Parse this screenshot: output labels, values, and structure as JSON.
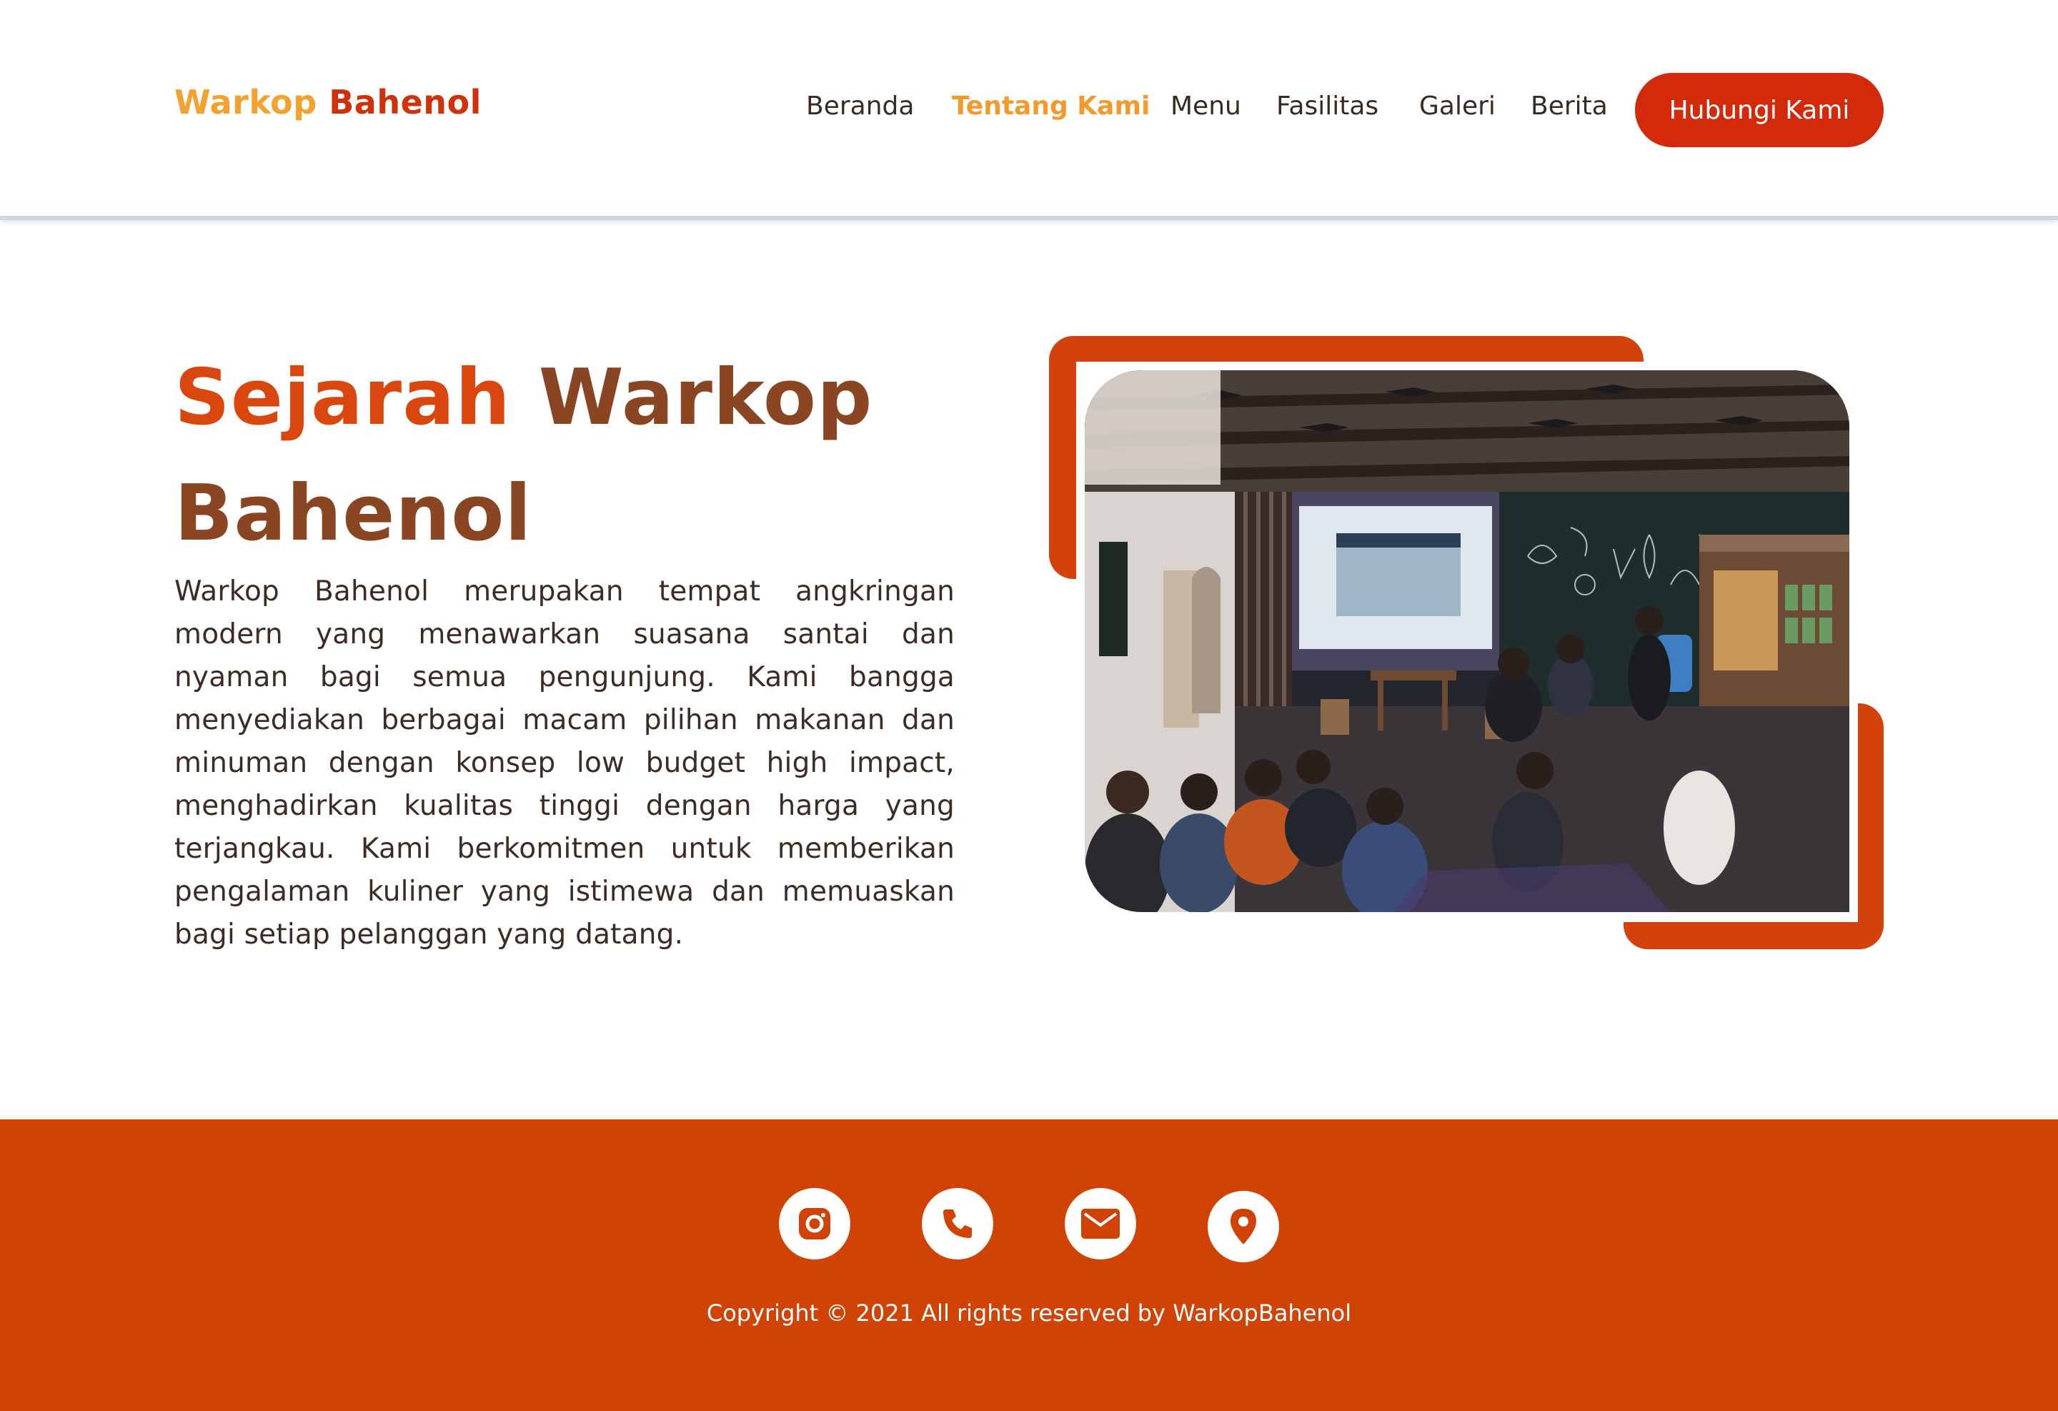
{
  "header": {
    "logo_part1": "Warkop",
    "logo_part2": "Bahenol",
    "nav": [
      {
        "label": "Beranda"
      },
      {
        "label": "Tentang Kami"
      },
      {
        "label": "Menu"
      },
      {
        "label": "Fasilitas"
      },
      {
        "label": "Galeri"
      },
      {
        "label": "Berita"
      }
    ],
    "active_nav": "Tentang Kami",
    "cta_label": "Hubungi Kami"
  },
  "main": {
    "title_part1": "Sejarah",
    "title_part2": "Warkop Bahenol",
    "description": "Warkop Bahenol merupakan tempat angkringan modern yang menawarkan suasana santai dan nyaman bagi semua pengunjung. Kami bangga menyediakan berbagai macam pilihan makanan dan minuman dengan konsep low budget high impact, menghadirkan kualitas tinggi dengan harga yang terjangkau. Kami berkomitmen untuk memberikan pengalaman kuliner yang istimewa dan memuaskan bagi setiap pelanggan yang datang."
  },
  "footer": {
    "social_icons": [
      "instagram-icon",
      "phone-icon",
      "mail-icon",
      "location-pin-icon"
    ],
    "copyright": "Copyright © 2021 All rights reserved by WarkopBahenol"
  },
  "colors": {
    "brand_orange": "#f29a2c",
    "brand_red": "#d42a0c",
    "footer_bg": "#d14304",
    "title_brown": "#8a4622"
  }
}
